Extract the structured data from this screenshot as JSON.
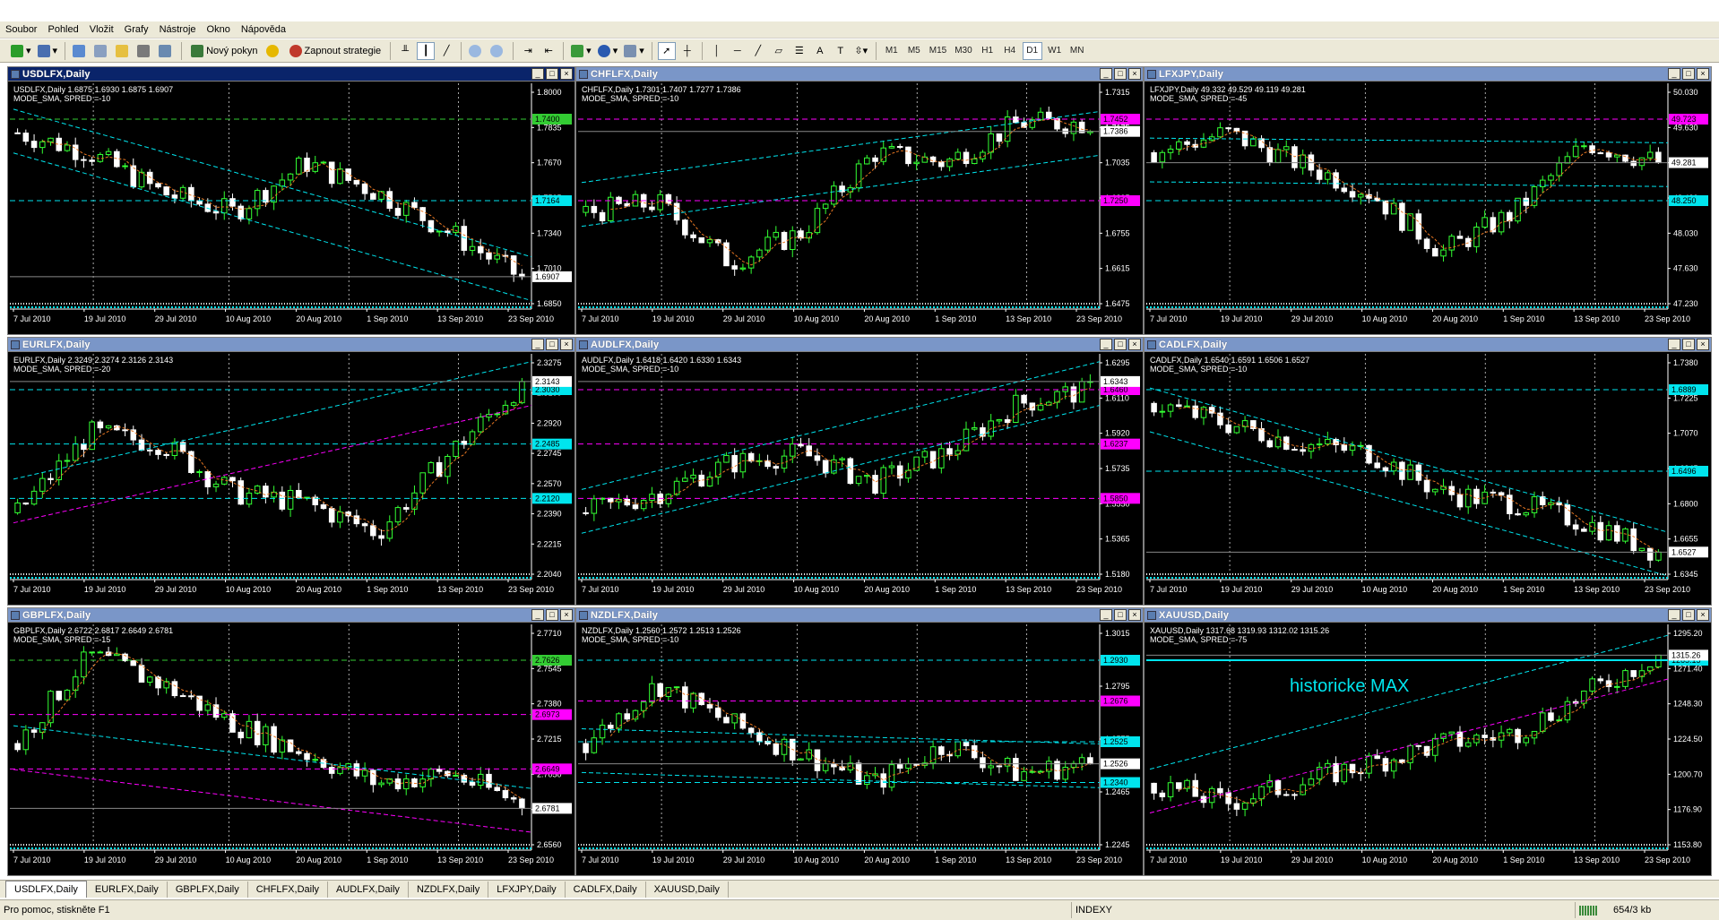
{
  "menu": [
    "Soubor",
    "Pohled",
    "Vložit",
    "Grafy",
    "Nástroje",
    "Okno",
    "Nápověda"
  ],
  "toolbar": {
    "new_order": "Nový pokyn",
    "autotrading": "Zapnout strategie",
    "timeframes": [
      "M1",
      "M5",
      "M15",
      "M30",
      "H1",
      "H4",
      "D1",
      "W1",
      "MN"
    ],
    "selected_timeframe": "D1"
  },
  "date_axis": [
    "7 Jul 2010",
    "19 Jul 2010",
    "29 Jul 2010",
    "10 Aug 2010",
    "20 Aug 2010",
    "1 Sep 2010",
    "13 Sep 2010",
    "23 Sep 2010"
  ],
  "charts": [
    {
      "title": "USDLFX,Daily",
      "info": "USDLFX,Daily  1.6875 1.6930 1.6875 1.6907",
      "mode": "MODE_SMA, SPRED =-10",
      "ticks": [
        "1.8000",
        "1.7835",
        "1.7670",
        "1.7505",
        "1.7340",
        "1.7010",
        "1.6850"
      ],
      "price": "1.6907",
      "levels": [
        {
          "text": "1.7400",
          "color": "#33cc33"
        },
        {
          "text": "1.7164",
          "color": "#00e5ee"
        }
      ]
    },
    {
      "title": "CHFLFX,Daily",
      "info": "CHFLFX,Daily  1.7301 1.7407 1.7277 1.7386",
      "mode": "MODE_SMA, SPRED =-10",
      "ticks": [
        "1.7315",
        "1.7175",
        "1.7035",
        "1.6895",
        "1.6755",
        "1.6615",
        "1.6475"
      ],
      "price": "1.7386",
      "levels": [
        {
          "text": "1.7452",
          "color": "#ff00ff"
        },
        {
          "text": "1.7250",
          "color": "#ff00ff"
        }
      ]
    },
    {
      "title": "LFXJPY,Daily",
      "info": "LFXJPY,Daily  49.332 49.529 49.119 49.281",
      "mode": "MODE_SMA, SPRED =-45",
      "ticks": [
        "50.030",
        "49.630",
        "48.830",
        "48.430",
        "48.030",
        "47.630",
        "47.230"
      ],
      "price": "49.281",
      "levels": [
        {
          "text": "49.723",
          "color": "#ff00ff"
        },
        {
          "text": "48.250",
          "color": "#00e5ee"
        }
      ]
    },
    {
      "title": "EURLFX,Daily",
      "info": "EURLFX,Daily  2.3249 2.3274 2.3126 2.3143",
      "mode": "MODE_SMA, SPRED =-20",
      "ticks": [
        "2.3275",
        "2.3100",
        "2.2920",
        "2.2745",
        "2.2570",
        "2.2390",
        "2.2215",
        "2.2040"
      ],
      "price": "2.3143",
      "levels": [
        {
          "text": "2.3030",
          "color": "#00e5ee"
        },
        {
          "text": "2.2485",
          "color": "#00e5ee"
        },
        {
          "text": "2.2120",
          "color": "#00e5ee"
        }
      ]
    },
    {
      "title": "AUDLFX,Daily",
      "info": "AUDLFX,Daily  1.6418 1.6420 1.6330 1.6343",
      "mode": "MODE_SMA, SPRED =-10",
      "ticks": [
        "1.6295",
        "1.6110",
        "1.5920",
        "1.5735",
        "1.5550",
        "1.5365",
        "1.5180"
      ],
      "price": "1.6343",
      "levels": [
        {
          "text": "1.6460",
          "color": "#ff00ff"
        },
        {
          "text": "1.6237",
          "color": "#ff00ff"
        },
        {
          "text": "1.5850",
          "color": "#ff00ff"
        }
      ]
    },
    {
      "title": "CADLFX,Daily",
      "info": "CADLFX,Daily  1.6540 1.6591 1.6506 1.6527",
      "mode": "MODE_SMA, SPRED =-10",
      "ticks": [
        "1.7380",
        "1.7225",
        "1.7070",
        "1.6945",
        "1.6800",
        "1.6655",
        "1.6345"
      ],
      "price": "1.6527",
      "levels": [
        {
          "text": "1.6889",
          "color": "#00e5ee"
        },
        {
          "text": "1.6496",
          "color": "#00e5ee"
        }
      ]
    },
    {
      "title": "GBPLFX,Daily",
      "info": "GBPLFX,Daily  2.6722 2.6817 2.6649 2.6781",
      "mode": "MODE_SMA, SPRED =-15",
      "ticks": [
        "2.7710",
        "2.7545",
        "2.7380",
        "2.7215",
        "2.7050",
        "2.6720",
        "2.6560"
      ],
      "price": "2.6781",
      "levels": [
        {
          "text": "2.7626",
          "color": "#33cc33"
        },
        {
          "text": "2.6973",
          "color": "#ff00ff"
        },
        {
          "text": "2.6649",
          "color": "#ff00ff"
        }
      ]
    },
    {
      "title": "NZDLFX,Daily",
      "info": "NZDLFX,Daily  1.2560 1.2572 1.2513 1.2526",
      "mode": "MODE_SMA, SPRED =-10",
      "ticks": [
        "1.3015",
        "1.2795",
        "1.2575",
        "1.2465",
        "1.2245"
      ],
      "price": "1.2526",
      "levels": [
        {
          "text": "1.2930",
          "color": "#00e5ee"
        },
        {
          "text": "1.2676",
          "color": "#ff00ff"
        },
        {
          "text": "1.2525",
          "color": "#00e5ee"
        },
        {
          "text": "1.2340",
          "color": "#00e5ee"
        }
      ]
    },
    {
      "title": "XAUUSD,Daily",
      "info": "XAUUSD,Daily  1317.68 1319.93 1312.02 1315.26",
      "mode": "MODE_SMA, SPRED =-75",
      "ticks": [
        "1295.20",
        "1271.40",
        "1248.30",
        "1224.50",
        "1200.70",
        "1176.90",
        "1153.80"
      ],
      "price": "1315.26",
      "levels": [
        {
          "text": "1265.15",
          "color": "#00e5ee"
        }
      ],
      "annotation": "historicke  MAX"
    }
  ],
  "tabs": [
    "USDLFX,Daily",
    "EURLFX,Daily",
    "GBPLFX,Daily",
    "CHFLFX,Daily",
    "AUDLFX,Daily",
    "NZDLFX,Daily",
    "LFXJPY,Daily",
    "CADLFX,Daily",
    "XAUUSD,Daily"
  ],
  "active_tab": "USDLFX,Daily",
  "status": {
    "help": "Pro pomoc, stiskněte F1",
    "profile": "INDEXY",
    "traffic": "654/3 kb"
  },
  "colors": {
    "bull": "#33ff33",
    "bear": "#ffffff",
    "axis": "#ffffff",
    "background": "#000000",
    "cyan": "#00e5ee",
    "magenta": "#ff00ff",
    "green": "#33cc33",
    "orange": "#e87722"
  }
}
